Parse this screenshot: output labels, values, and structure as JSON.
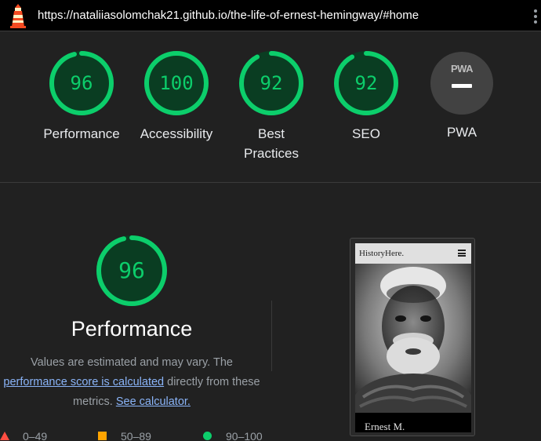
{
  "topbar": {
    "url": "https://nataliiasolomchak21.github.io/the-life-of-ernest-hemingway/#home",
    "logo_icon": "lighthouse-icon",
    "menu_icon": "kebab-menu-icon"
  },
  "summary": [
    {
      "score": "96",
      "label": "Performance",
      "value": 96
    },
    {
      "score": "100",
      "label": "Accessibility",
      "value": 100
    },
    {
      "score": "92",
      "label": "Best Practices",
      "value": 92
    },
    {
      "score": "92",
      "label": "SEO",
      "value": 92
    }
  ],
  "pwa": {
    "badge": "PWA",
    "label": "PWA"
  },
  "performance": {
    "score": "96",
    "value": 96,
    "title": "Performance",
    "desc_before": "Values are estimated and may vary. The",
    "desc_link": "performance score is calculated",
    "desc_mid": "directly from these metrics.",
    "calc_link": "See calculator."
  },
  "legend": [
    {
      "range": "0–49",
      "shape": "triangle",
      "color": "#ff4e42"
    },
    {
      "range": "50–89",
      "shape": "square",
      "color": "#ffa400"
    },
    {
      "range": "90–100",
      "shape": "circle",
      "color": "#0cce6b"
    }
  ],
  "screenshot": {
    "brand": "HistoryHere.",
    "caption": "Ernest M.",
    "menu_icon": "hamburger-menu-icon"
  },
  "colors": {
    "pass": "#0cce6b",
    "pass_bg": "#0a3d22",
    "background": "#212121"
  }
}
